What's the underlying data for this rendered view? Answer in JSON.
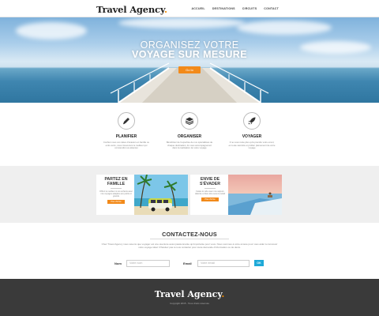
{
  "header": {
    "logo_text": "Travel Agency",
    "logo_dot": ".",
    "nav": [
      "ACCUEIL",
      "DESTINATIONS",
      "CIRCUITS",
      "CONTACT"
    ]
  },
  "hero": {
    "line1": "ORGANISEZ VOTRE",
    "line2": "VOYAGE SUR MESURE",
    "button": "Go to"
  },
  "services": [
    {
      "title": "PLANIFIER",
      "icon": "pen-icon",
      "desc": "Confiez-nous vos idées d'évasion en famille ou entre amis, nous trouverons le meilleur qui conviendra vos attentes"
    },
    {
      "title": "ORGANISER",
      "icon": "layers-icon",
      "desc": "Bénéficiez de l'expertise de nos spécialistes de chaque destination, ils vous accompagneront dans la réalisation de votre voyage"
    },
    {
      "title": "VOYAGER",
      "icon": "rocket-icon",
      "desc": "Il ne vous reste plus qu'à prendre votre envol, en toute sérénité et profiter pleinement de votre voyage"
    }
  ],
  "cards": [
    {
      "title": "PARTEZ EN FAMILLE",
      "desc": "Offrez le meilleur à vos enfants avec nos voyages adaptés aux petits et grands",
      "button": "Plus d'infos"
    },
    {
      "title": "ENVIE DE S'ÉVADER",
      "desc": "Faites le vide avec nos séjours détente et bien-être sous le soleil",
      "button": "Plus d'infos"
    }
  ],
  "contact": {
    "title": "CONTACTEZ-NOUS",
    "desc": "Chez Travel Agency nous savons que voyager est une aventure aussi passionnante qu'importante pour vous. Nous sommes à votre écoute pour vous aider à concevoir votre voyage idéal. N'hésitez pas à nous contacter pour toute demande d'information ou de devis.",
    "name_label": "Nom",
    "name_placeholder": "Votre nom",
    "email_label": "Email",
    "email_placeholder": "Votre email",
    "ok": "OK"
  },
  "footer": {
    "logo_text": "Travel Agency",
    "logo_dot": ".",
    "copyright": "Copyright 2015 - Tous droits réservés"
  },
  "colors": {
    "accent": "#f28a1a",
    "button_blue": "#1ea9d8",
    "footer_bg": "#3a3a3a"
  }
}
